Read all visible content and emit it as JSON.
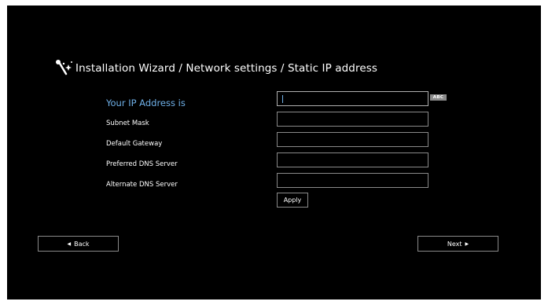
{
  "header": {
    "title": "Installation Wizard / Network settings / Static IP address",
    "icon": "wand-icon"
  },
  "form": {
    "fields": [
      {
        "label": "Your IP Address is",
        "value": "",
        "active": true
      },
      {
        "label": "Subnet Mask",
        "value": ""
      },
      {
        "label": "Default Gateway",
        "value": ""
      },
      {
        "label": "Preferred DNS Server",
        "value": ""
      },
      {
        "label": "Alternate DNS Server",
        "value": ""
      }
    ],
    "input_mode_badge": "ABC",
    "apply_label": "Apply"
  },
  "navigation": {
    "back_label": "Back",
    "next_label": "Next",
    "back_icon": "triangle-left-icon",
    "next_icon": "triangle-right-icon"
  },
  "colors": {
    "background": "#000000",
    "text": "#ffffff",
    "active_label": "#6fb0e8",
    "border": "#8a8a8a",
    "badge": "#8a8a8a"
  }
}
